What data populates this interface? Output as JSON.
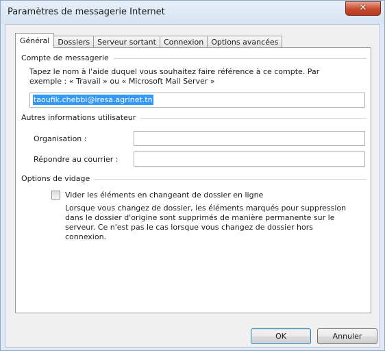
{
  "window": {
    "title": "Paramètres de messagerie Internet",
    "close_icon": "close-icon"
  },
  "tabs": [
    {
      "label": "Général",
      "active": true
    },
    {
      "label": "Dossiers",
      "active": false
    },
    {
      "label": "Serveur sortant",
      "active": false
    },
    {
      "label": "Connexion",
      "active": false
    },
    {
      "label": "Options avancées",
      "active": false
    }
  ],
  "account": {
    "title": "Compte de messagerie",
    "description_line1": "Tapez le nom à l'aide duquel vous souhaitez faire référence à ce compte. Par",
    "description_line2": "exemple : « Travail » ou « Microsoft Mail Server »",
    "name_value": "taoufik.chebbi@iresa.agrinet.tn"
  },
  "other_info": {
    "title": "Autres informations utilisateur",
    "organisation_label": "Organisation :",
    "organisation_value": "",
    "reply_label": "Répondre au courrier :",
    "reply_value": ""
  },
  "purge": {
    "title": "Options de vidage",
    "checkbox_label": "Vider les éléments en changeant de dossier en ligne",
    "checked": false,
    "help_line1": "Lorsque vous changez de dossier, les éléments marqués pour suppression",
    "help_line2": "dans le dossier d'origine sont supprimés de manière permanente sur le",
    "help_line3": "serveur. Ce n'est pas le cas lorsque vous changez de dossier hors",
    "help_line4": "connexion."
  },
  "buttons": {
    "ok_label": "OK",
    "cancel_label": "Annuler"
  }
}
